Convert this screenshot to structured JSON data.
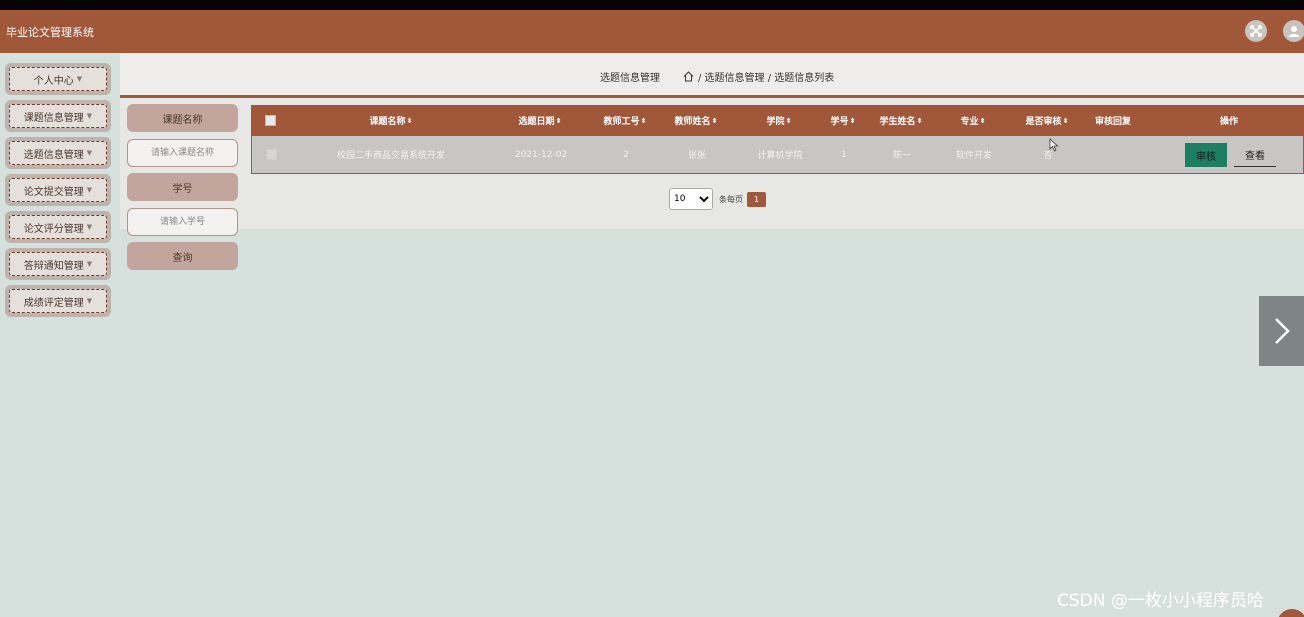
{
  "app": {
    "title": "毕业论文管理系统"
  },
  "header": {
    "fullscreen_icon": "fullscreen-icon",
    "user_icon": "user-icon"
  },
  "sidebar": {
    "items": [
      {
        "label": "个人中心"
      },
      {
        "label": "课题信息管理"
      },
      {
        "label": "选题信息管理"
      },
      {
        "label": "论文提交管理"
      },
      {
        "label": "论文评分管理"
      },
      {
        "label": "答辩通知管理"
      },
      {
        "label": "成绩评定管理"
      }
    ]
  },
  "breadcrumb": {
    "page_title": "选题信息管理",
    "path": "/ 选题信息管理 / 选题信息列表"
  },
  "search": {
    "topic_label": "课题名称",
    "topic_placeholder": "请输入课题名称",
    "student_no_label": "学号",
    "student_no_placeholder": "请输入学号",
    "query_label": "查询"
  },
  "table": {
    "columns": [
      "课题名称",
      "选题日期",
      "教师工号",
      "教师姓名",
      "学院",
      "学号",
      "学生姓名",
      "专业",
      "是否审核",
      "审核回复",
      "操作"
    ],
    "rows": [
      {
        "topic": "校园二手商品交易系统开发",
        "date": "2021-12-02",
        "teacher_no": "2",
        "teacher_name": "张张",
        "college": "计算机学院",
        "student_no": "1",
        "student_name": "陈一",
        "major": "软件开发",
        "audited": "否",
        "reply": "",
        "audit_label": "审核",
        "view_label": "查看"
      }
    ]
  },
  "pager": {
    "page_size": "10",
    "page_size_options": [
      "10"
    ],
    "per_page_label": "条每页",
    "current_page": "1"
  },
  "watermark": "CSDN @一枚小小程序员哈"
}
